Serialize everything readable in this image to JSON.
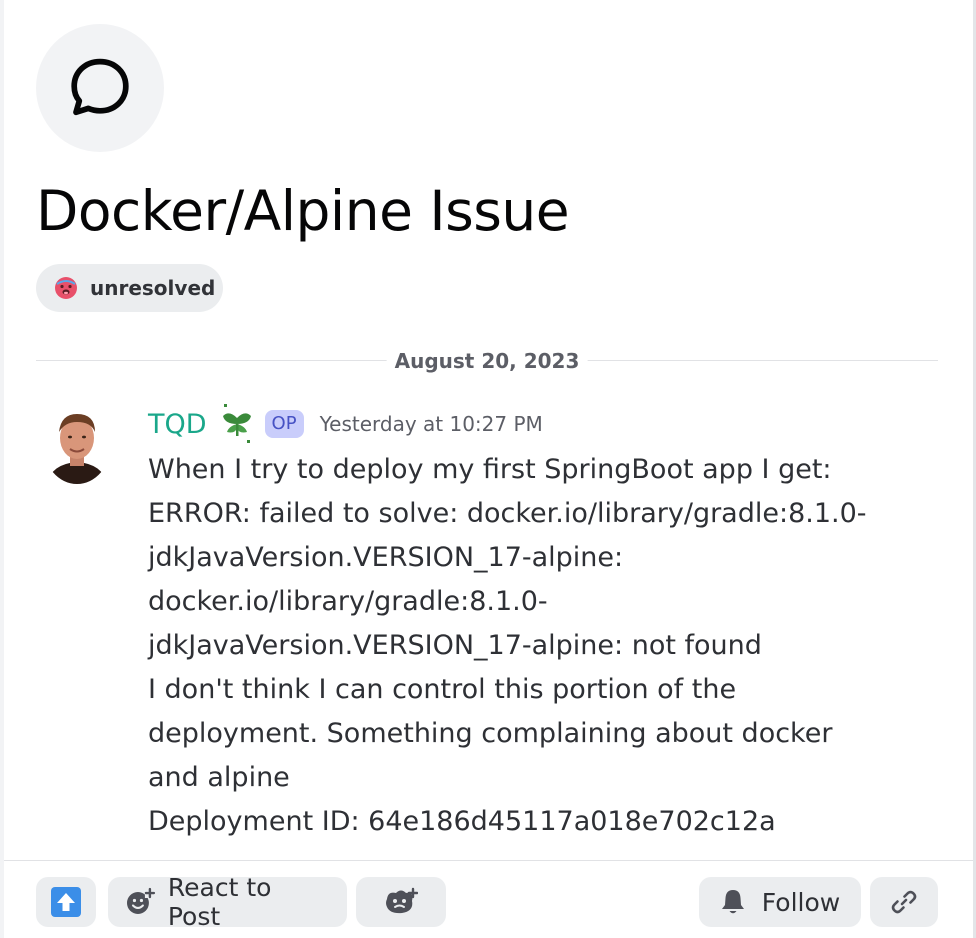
{
  "post": {
    "title": "Docker/Alpine Issue",
    "tag": {
      "label": "unresolved",
      "emoji": "hot-face-emoji"
    },
    "date_divider": "August 20, 2023"
  },
  "message": {
    "author": "TQD",
    "role_icon": "sprout-icon",
    "op_badge": "OP",
    "timestamp": "Yesterday at 10:27 PM",
    "lines": [
      "When I try to deploy my first SpringBoot app I get:",
      "ERROR: failed to solve: docker.io/library/gradle:8.1.0-",
      "jdkJavaVersion.VERSION_17-alpine:",
      "docker.io/library/gradle:8.1.0-",
      "jdkJavaVersion.VERSION_17-alpine: not found",
      "I don't think I can control this portion of the",
      "deployment. Something complaining about docker",
      "and alpine",
      "Deployment ID: 64e186d45117a018e702c12a"
    ]
  },
  "footer": {
    "react_label": "React to Post",
    "follow_label": "Follow"
  },
  "colors": {
    "username": "#1aa78a",
    "op_badge_bg": "#c9cdfb",
    "upvote_blue": "#3b8ee8"
  }
}
